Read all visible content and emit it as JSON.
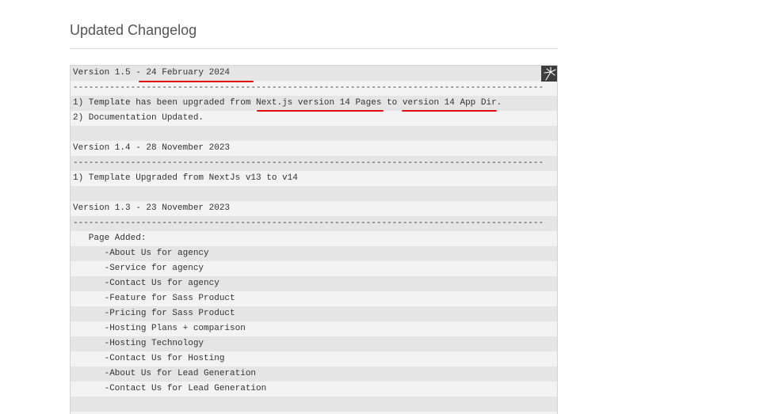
{
  "page": {
    "title": "Updated Changelog"
  },
  "changelog": {
    "lines": [
      "Version 1.5 - 24 February 2024",
      "------------------------------------------------------------------------------------------",
      "1) Template has been upgraded from Next.js version 14 Pages to version 14 App Dir.",
      "2) Documentation Updated.",
      "",
      "Version 1.4 - 28 November 2023",
      "------------------------------------------------------------------------------------------",
      "1) Template Upgraded from NextJs v13 to v14",
      "",
      "Version 1.3 - 23 November 2023",
      "------------------------------------------------------------------------------------------",
      "   Page Added:",
      "      -About Us for agency",
      "      -Service for agency",
      "      -Contact Us for agency",
      "      -Feature for Sass Product",
      "      -Pricing for Sass Product",
      "      -Hosting Plans + comparison",
      "      -Hosting Technology",
      "      -Contact Us for Hosting",
      "      -About Us for Lead Generation",
      "      -Contact Us for Lead Generation",
      "",
      ""
    ]
  },
  "toolbar": {
    "icon": "popout-icon"
  },
  "colors": {
    "annotation": "#e01010",
    "row_dark": "#e5e5e5",
    "row_light": "#f3f3f3"
  }
}
